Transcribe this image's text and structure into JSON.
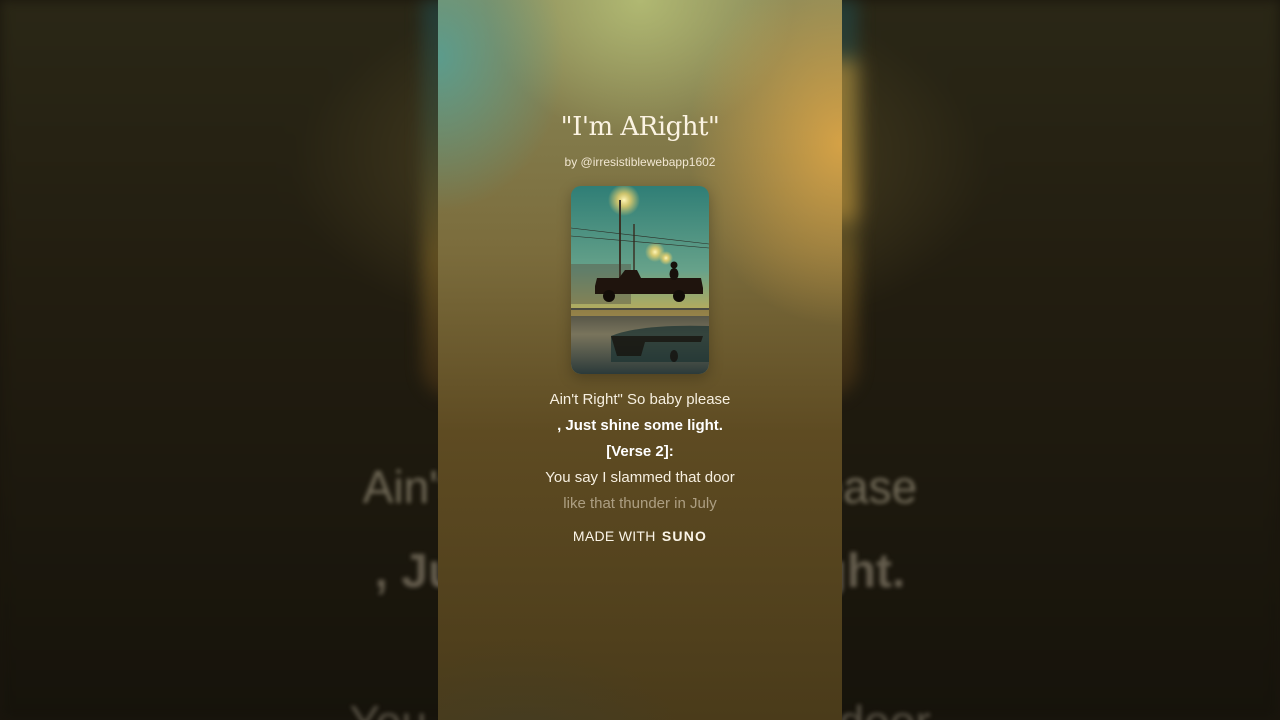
{
  "song": {
    "title": "\"I'm ARight\"",
    "artist": "by @irresistiblewebapp1602"
  },
  "cover_art": {
    "subject": "pickup-truck-at-dusk-under-streetlights"
  },
  "lyrics": [
    "Ain't Right\" So baby please",
    ", Just shine some light.",
    "[Verse 2]:",
    "You say I slammed that door",
    "like that thunder in July"
  ],
  "background_lyrics": {
    "line_1": "Ain't Right\" So baby please",
    "line_2": ", Just shine some light.",
    "line_3": "You say I slammed that door"
  },
  "footer": {
    "made_with": "MADE WITH",
    "brand": "SUNO"
  },
  "colors": {
    "panel_teal": "#54a096",
    "panel_gold": "#dea646",
    "text_cream": "#fbf3e2"
  }
}
